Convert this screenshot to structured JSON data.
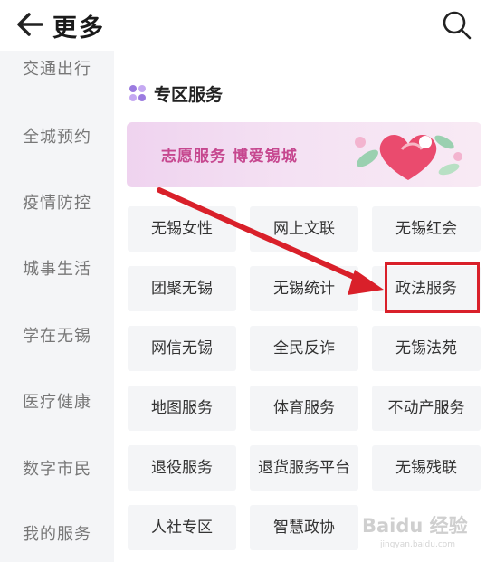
{
  "header": {
    "title": "更多",
    "back_icon": "arrow-left-icon",
    "search_icon": "search-icon"
  },
  "sidebar": {
    "items": [
      {
        "label": "交通出行"
      },
      {
        "label": "全城预约"
      },
      {
        "label": "疫情防控"
      },
      {
        "label": "城事生活"
      },
      {
        "label": "学在无锡"
      },
      {
        "label": "医疗健康"
      },
      {
        "label": "数字市民"
      },
      {
        "label": "我的服务"
      }
    ]
  },
  "section": {
    "icon": "grid-icon",
    "title": "专区服务"
  },
  "banner": {
    "text": "志愿服务  博爱锡城"
  },
  "tiles": [
    {
      "label": "无锡女性"
    },
    {
      "label": "网上文联"
    },
    {
      "label": "无锡红会"
    },
    {
      "label": "团聚无锡"
    },
    {
      "label": "无锡统计"
    },
    {
      "label": "政法服务"
    },
    {
      "label": "网信无锡"
    },
    {
      "label": "全民反诈"
    },
    {
      "label": "无锡法苑"
    },
    {
      "label": "地图服务"
    },
    {
      "label": "体育服务"
    },
    {
      "label": "不动产服务"
    },
    {
      "label": "退役服务"
    },
    {
      "label": "退货服务平台"
    },
    {
      "label": "无锡残联"
    },
    {
      "label": "人社专区"
    },
    {
      "label": "智慧政协"
    }
  ],
  "annotation": {
    "highlight_color": "#d9202a"
  },
  "watermark": {
    "text": "Baidu 经验",
    "sub": "jingyan.baidu.com"
  },
  "colors": {
    "sidebar_bg": "#f4f5f7",
    "tile_bg": "#f4f5f7",
    "banner_text": "#c6478f",
    "accent_purple": "#9b7be0"
  }
}
